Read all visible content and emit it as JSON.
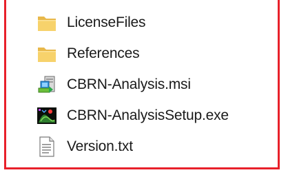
{
  "colors": {
    "frame_border": "#e8202a",
    "folder_yellow": "#f7d26b",
    "text": "#1a1a1a"
  },
  "file_list": {
    "items": [
      {
        "name": "LicenseFiles",
        "icon": "folder-icon"
      },
      {
        "name": "References",
        "icon": "folder-icon"
      },
      {
        "name": "CBRN-Analysis.msi",
        "icon": "msi-installer-icon"
      },
      {
        "name": "CBRN-AnalysisSetup.exe",
        "icon": "setup-exe-icon"
      },
      {
        "name": "Version.txt",
        "icon": "text-file-icon"
      }
    ]
  }
}
